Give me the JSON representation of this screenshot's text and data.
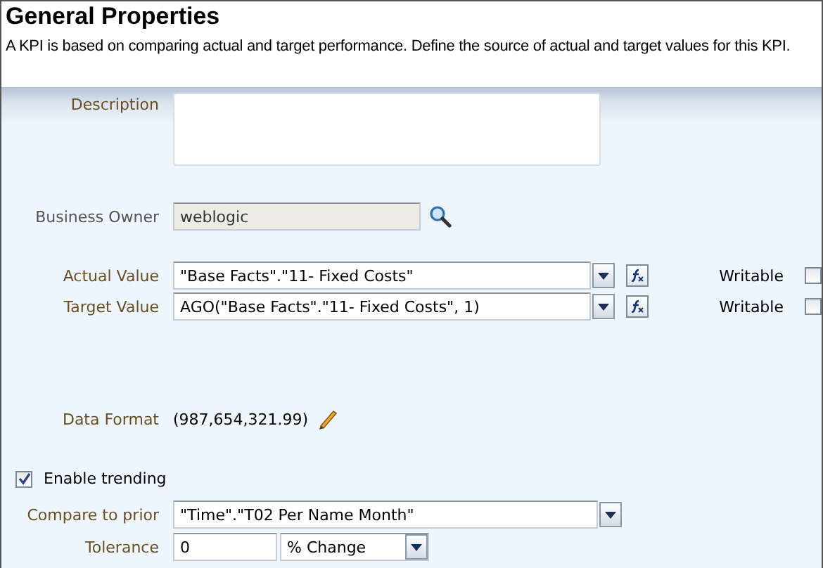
{
  "title": "General Properties",
  "intro": "A KPI is based on comparing actual and target performance. Define the source of actual and target values for this KPI.",
  "description": {
    "label": "Description"
  },
  "business_owner": {
    "label": "Business Owner",
    "value": "weblogic"
  },
  "values": [
    {
      "label": "Actual Value",
      "value": "\"Base Facts\".\"11- Fixed Costs\"",
      "writable_label": "Writable",
      "writable": false
    },
    {
      "label": "Target Value",
      "value": "AGO(\"Base Facts\".\"11- Fixed Costs\", 1)",
      "writable_label": "Writable",
      "writable": false
    }
  ],
  "data_format": {
    "label": "Data Format",
    "value": "(987,654,321.99)"
  },
  "trending": {
    "label": "Enable trending",
    "checked": true,
    "compare_label": "Compare to prior",
    "compare_value": "\"Time\".\"T02 Per Name Month\"",
    "tolerance_label": "Tolerance",
    "tolerance_value": "0",
    "tolerance_unit": "% Change"
  }
}
